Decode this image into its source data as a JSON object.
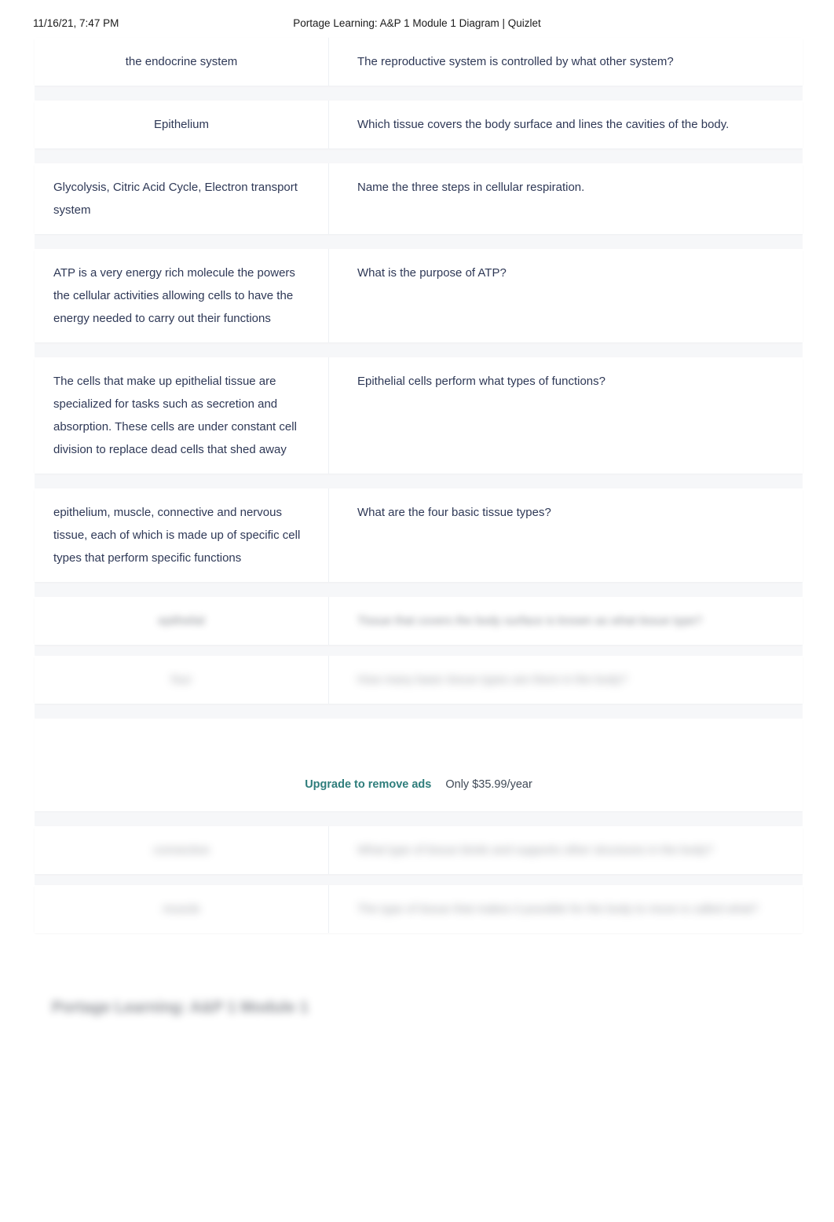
{
  "print_header": {
    "date": "11/16/21, 7:47 PM",
    "document_title": "Portage Learning: A&P 1 Module 1 Diagram | Quizlet"
  },
  "colors": {
    "accent_teal": "#2e7d7b",
    "text": "#2e3856",
    "page_background": "#ffffff",
    "row_gap": "#f6f7f9",
    "divider": "#edf0f4"
  },
  "flashcards": [
    {
      "term": "the endocrine system",
      "definition": "The reproductive system is controlled by what other system?",
      "blurred": false,
      "term_align": "center"
    },
    {
      "term": "Epithelium",
      "definition": "Which tissue covers the body surface and lines the cavities of the body.",
      "blurred": false,
      "term_align": "center"
    },
    {
      "term": "Glycolysis, Citric Acid Cycle, Electron transport system",
      "definition": "Name the three steps in cellular respiration.",
      "blurred": false,
      "term_align": "left"
    },
    {
      "term": "ATP is a very energy rich molecule the powers the cellular activities allowing cells to have the energy needed to carry out their functions",
      "definition": "What is the purpose of ATP?",
      "blurred": false,
      "term_align": "left"
    },
    {
      "term": "The cells that make up epithelial tissue are specialized for tasks such as secretion and absorption. These cells are under constant cell division to replace dead cells that shed away",
      "definition": "Epithelial cells perform what types of functions?",
      "blurred": false,
      "term_align": "left"
    },
    {
      "term": "epithelium, muscle, connective and nervous tissue, each of which is made up of specific cell types that perform specific functions",
      "definition": "What are the four basic tissue types?",
      "blurred": false,
      "term_align": "left"
    },
    {
      "term": "epithelial",
      "definition": "Tissue that covers the body surface is known as what tissue type?",
      "blurred": true,
      "term_align": "center"
    },
    {
      "term": "four",
      "definition": "How many basic tissue types are there in the body?",
      "blurred": true,
      "term_align": "center"
    }
  ],
  "advertisement": {
    "upgrade_label": "Upgrade to remove ads",
    "price_label": "Only $35.99/year"
  },
  "flashcards_after_ad": [
    {
      "term": "connective",
      "definition": "What type of tissue binds and supports other structures in the body?",
      "blurred": true,
      "term_align": "center"
    },
    {
      "term": "muscle",
      "definition": "The type of tissue that makes it possible for the body to move is called what?",
      "blurred": true,
      "term_align": "center"
    }
  ],
  "footer": {
    "blurred_text": "Portage Learning: A&P 1 Module 1"
  }
}
